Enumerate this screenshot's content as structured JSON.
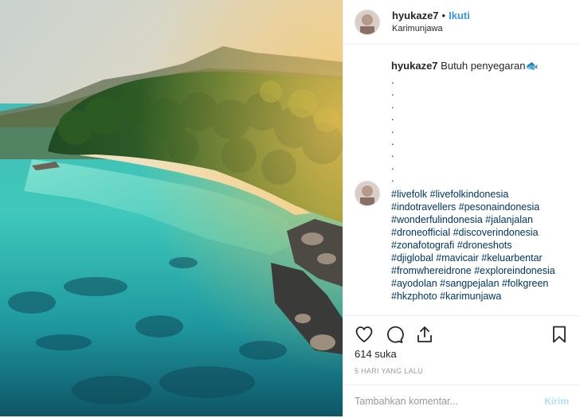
{
  "post": {
    "username": "hyukaze7",
    "separator": "•",
    "follow_label": "Ikuti",
    "location": "Karimunjawa",
    "caption_text": "Butuh penyegaran",
    "caption_emoji": "🐟",
    "dot_lines": [
      ".",
      ".",
      ".",
      ".",
      ".",
      ".",
      ".",
      ".",
      "."
    ],
    "hashtag_lines": [
      "#livefolk #livefolkindonesia",
      "#indotravellers #pesonaindonesia",
      "#wonderfulindonesia #jalanjalan",
      "#droneofficial #discoverindonesia",
      "#zonafotografi #droneshots",
      "#djiglobal #mavicair #keluarbentar",
      "#fromwhereidrone #exploreindonesia",
      "#ayodolan #sangpejalan #folkgreen",
      "#hkzphoto #karimunjawa"
    ],
    "likes": "614 suka",
    "time": "5 HARI YANG LALU",
    "comment_placeholder": "Tambahkan komentar...",
    "post_button": "Kirim"
  },
  "colors": {
    "link": "#3897f0",
    "hashtag": "#003569",
    "post_disabled": "#b2dffc"
  },
  "icons": [
    "heart-icon",
    "comment-icon",
    "share-icon",
    "bookmark-icon"
  ]
}
